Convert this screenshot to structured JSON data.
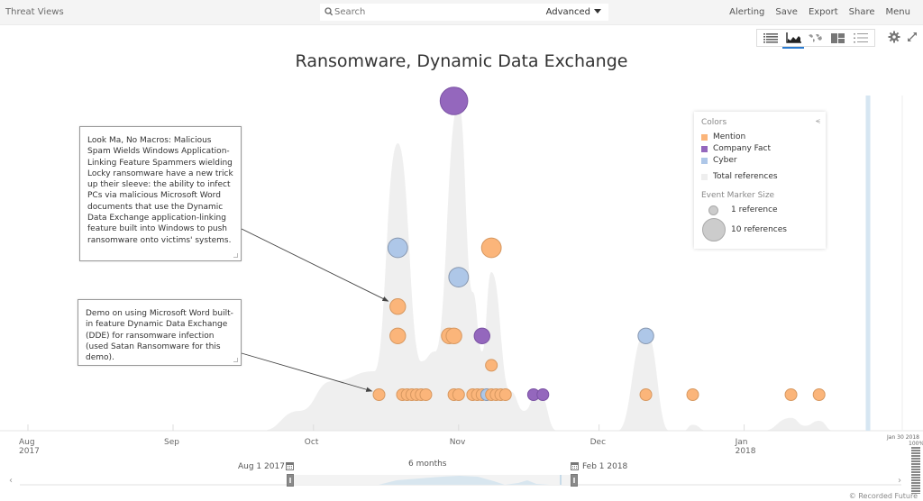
{
  "app": {
    "title": "Threat Views",
    "search_placeholder": "Search",
    "advanced_label": "Advanced",
    "nav": [
      "Alerting",
      "Save",
      "Export",
      "Share",
      "Menu"
    ]
  },
  "toolbar": {
    "views": [
      {
        "name": "list-view",
        "active": false
      },
      {
        "name": "timeline-view",
        "active": true
      },
      {
        "name": "map-view",
        "active": false
      },
      {
        "name": "table-view",
        "active": false
      },
      {
        "name": "detail-list-view",
        "active": false
      }
    ],
    "accent": "#2b7bd0"
  },
  "annotations": [
    {
      "text": "Look Ma, No Macros: Malicious Spam Wields Windows Application-Linking Feature Spammers wielding Locky ransomware have a new trick up their sleeve: the ability to infect PCs via malicious Microsoft Word documents that use the Dynamic Data Exchange application-linking feature built into Windows to push ransomware onto victims' systems.",
      "target_date": "2017-10-19",
      "target_row": 4
    },
    {
      "text": "Demo on using Microsoft Word built-in feature Dynamic Data Exchange (DDE) for ransomware infection (used Satan Ransomware for this demo).",
      "target_date": "2017-10-15",
      "target_row": 1
    }
  ],
  "legend": {
    "colors_label": "Colors",
    "collapse_icon": "double-chevron-down",
    "items": [
      {
        "label": "Mention",
        "color": "#fbb57a"
      },
      {
        "label": "Company Fact",
        "color": "#9467bd"
      },
      {
        "label": "Cyber",
        "color": "#aec7e8"
      }
    ],
    "total_label": "Total references",
    "size_label": "Event Marker Size",
    "size_small": "1 reference",
    "size_big": "10 references"
  },
  "range": {
    "start": "Aug 1 2017",
    "end": "Feb 1 2018",
    "span": "6 months",
    "end_marker": "Jan 30 2018",
    "zoom_pct": "100%"
  },
  "copyright": "© Recorded Future",
  "chart_data": {
    "type": "scatter",
    "title": "Ransomware, Dynamic Data Exchange",
    "xlabel": "",
    "ylabel": "",
    "x_range": [
      "2017-08-01",
      "2018-01-30"
    ],
    "x_ticks": [
      {
        "date": "2017-08-01",
        "label": "Aug",
        "sub": "2017"
      },
      {
        "date": "2017-09-01",
        "label": "Sep",
        "sub": ""
      },
      {
        "date": "2017-10-01",
        "label": "Oct",
        "sub": ""
      },
      {
        "date": "2017-11-01",
        "label": "Nov",
        "sub": ""
      },
      {
        "date": "2017-12-01",
        "label": "Dec",
        "sub": ""
      },
      {
        "date": "2018-01-01",
        "label": "Jan",
        "sub": "2018"
      }
    ],
    "grid": false,
    "legend_position": "top-right",
    "colors": {
      "Mention": "#fbb57a",
      "Company Fact": "#9467bd",
      "Cyber": "#aec7e8"
    },
    "events": [
      {
        "date": "2017-10-15",
        "row": 1,
        "type": "Mention",
        "refs": 1
      },
      {
        "date": "2017-10-20",
        "row": 1,
        "type": "Mention",
        "refs": 1
      },
      {
        "date": "2017-10-21",
        "row": 1,
        "type": "Mention",
        "refs": 1
      },
      {
        "date": "2017-10-22",
        "row": 1,
        "type": "Mention",
        "refs": 1
      },
      {
        "date": "2017-10-23",
        "row": 1,
        "type": "Mention",
        "refs": 1
      },
      {
        "date": "2017-10-24",
        "row": 1,
        "type": "Mention",
        "refs": 1
      },
      {
        "date": "2017-10-25",
        "row": 1,
        "type": "Mention",
        "refs": 1
      },
      {
        "date": "2017-10-31",
        "row": 1,
        "type": "Mention",
        "refs": 1
      },
      {
        "date": "2017-11-01",
        "row": 1,
        "type": "Mention",
        "refs": 1
      },
      {
        "date": "2017-11-04",
        "row": 1,
        "type": "Mention",
        "refs": 1
      },
      {
        "date": "2017-11-05",
        "row": 1,
        "type": "Mention",
        "refs": 1
      },
      {
        "date": "2017-11-06",
        "row": 1,
        "type": "Mention",
        "refs": 1
      },
      {
        "date": "2017-11-07",
        "row": 1,
        "type": "Cyber",
        "refs": 1
      },
      {
        "date": "2017-11-08",
        "row": 1,
        "type": "Mention",
        "refs": 1
      },
      {
        "date": "2017-11-09",
        "row": 1,
        "type": "Mention",
        "refs": 1
      },
      {
        "date": "2017-11-10",
        "row": 1,
        "type": "Mention",
        "refs": 1
      },
      {
        "date": "2017-11-11",
        "row": 1,
        "type": "Mention",
        "refs": 1
      },
      {
        "date": "2017-11-17",
        "row": 1,
        "type": "Company Fact",
        "refs": 1
      },
      {
        "date": "2017-11-19",
        "row": 1,
        "type": "Company Fact",
        "refs": 1
      },
      {
        "date": "2017-12-11",
        "row": 1,
        "type": "Mention",
        "refs": 1
      },
      {
        "date": "2017-12-21",
        "row": 1,
        "type": "Mention",
        "refs": 1
      },
      {
        "date": "2018-01-11",
        "row": 1,
        "type": "Mention",
        "refs": 1
      },
      {
        "date": "2018-01-17",
        "row": 1,
        "type": "Mention",
        "refs": 1
      },
      {
        "date": "2017-11-08",
        "row": 2,
        "type": "Mention",
        "refs": 1
      },
      {
        "date": "2017-10-19",
        "row": 3,
        "type": "Mention",
        "refs": 2
      },
      {
        "date": "2017-10-30",
        "row": 3,
        "type": "Mention",
        "refs": 2
      },
      {
        "date": "2017-10-31",
        "row": 3,
        "type": "Mention",
        "refs": 2
      },
      {
        "date": "2017-11-06",
        "row": 3,
        "type": "Company Fact",
        "refs": 2
      },
      {
        "date": "2017-12-11",
        "row": 3,
        "type": "Cyber",
        "refs": 2
      },
      {
        "date": "2017-10-19",
        "row": 4,
        "type": "Mention",
        "refs": 2
      },
      {
        "date": "2017-11-01",
        "row": 5,
        "type": "Cyber",
        "refs": 3
      },
      {
        "date": "2017-10-19",
        "row": 6,
        "type": "Cyber",
        "refs": 3
      },
      {
        "date": "2017-11-08",
        "row": 6,
        "type": "Mention",
        "refs": 3
      },
      {
        "date": "2017-10-31",
        "row": 11,
        "type": "Company Fact",
        "refs": 5
      }
    ],
    "total_references": {
      "dates": [
        "2017-09-20",
        "2017-09-28",
        "2017-10-05",
        "2017-10-14",
        "2017-10-19",
        "2017-10-24",
        "2017-10-27",
        "2017-11-01",
        "2017-11-04",
        "2017-11-06",
        "2017-11-08",
        "2017-11-12",
        "2017-11-15",
        "2017-11-18",
        "2017-11-22",
        "2017-12-05",
        "2017-12-11",
        "2017-12-16",
        "2017-12-19",
        "2017-12-21",
        "2017-12-24",
        "2018-01-05",
        "2018-01-11",
        "2018-01-14",
        "2018-01-17",
        "2018-01-20",
        "2018-01-30"
      ],
      "values": [
        0,
        2,
        5,
        6,
        29,
        7,
        8,
        33,
        14,
        8,
        16,
        4,
        2,
        4,
        0,
        0,
        10,
        0,
        0,
        0.6,
        0,
        0,
        1.3,
        0.5,
        1,
        0,
        0
      ]
    }
  }
}
